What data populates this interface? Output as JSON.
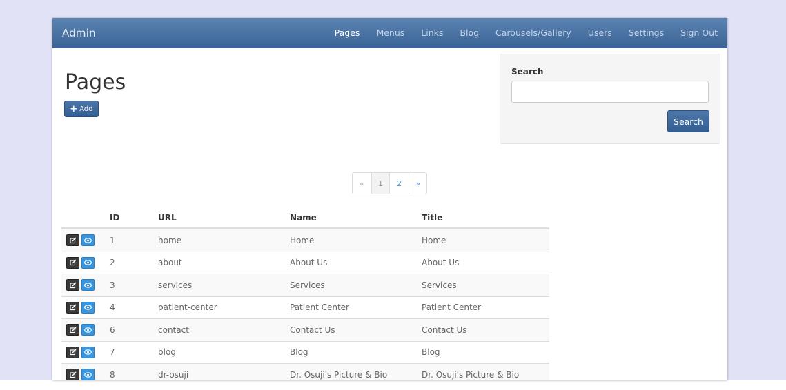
{
  "navbar": {
    "brand": "Admin",
    "links": [
      {
        "label": "Pages",
        "active": true
      },
      {
        "label": "Menus"
      },
      {
        "label": "Links"
      },
      {
        "label": "Blog"
      },
      {
        "label": "Carousels/Gallery"
      },
      {
        "label": "Users"
      },
      {
        "label": "Settings"
      },
      {
        "label": "Sign Out"
      }
    ]
  },
  "main": {
    "title": "Pages",
    "add_label": "Add"
  },
  "search": {
    "label": "Search",
    "value": "",
    "placeholder": "",
    "button_label": "Search"
  },
  "pagination": {
    "prev": "«",
    "pages": [
      "1",
      "2"
    ],
    "current": "1",
    "next": "»"
  },
  "table": {
    "headers": {
      "id": "ID",
      "url": "URL",
      "name": "Name",
      "title": "Title"
    },
    "rows": [
      {
        "id": "1",
        "url": "home",
        "name": "Home",
        "title": "Home"
      },
      {
        "id": "2",
        "url": "about",
        "name": "About Us",
        "title": "About Us"
      },
      {
        "id": "3",
        "url": "services",
        "name": "Services",
        "title": "Services"
      },
      {
        "id": "4",
        "url": "patient-center",
        "name": "Patient Center",
        "title": "Patient Center"
      },
      {
        "id": "6",
        "url": "contact",
        "name": "Contact Us",
        "title": "Contact Us"
      },
      {
        "id": "7",
        "url": "blog",
        "name": "Blog",
        "title": "Blog"
      },
      {
        "id": "8",
        "url": "dr-osuji",
        "name": "Dr. Osuji's Picture & Bio",
        "title": "Dr. Osuji's Picture & Bio"
      }
    ]
  },
  "icons": {
    "add": "plus-icon",
    "edit": "edit-icon",
    "view": "eye-icon"
  },
  "colors": {
    "navbar": "#4a73a5",
    "primary_button": "#3d6899",
    "view_button": "#3a95df",
    "edit_button": "#3a3a3a",
    "link": "#4a8fd0"
  }
}
